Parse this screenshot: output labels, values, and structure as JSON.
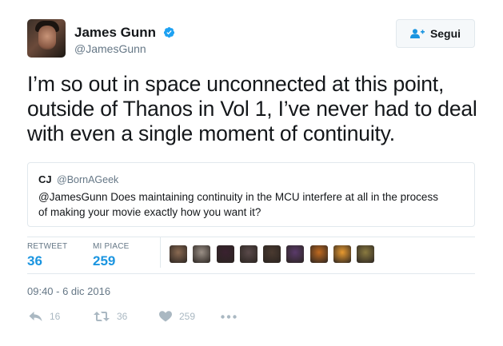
{
  "author": {
    "name": "James Gunn",
    "handle": "@JamesGunn",
    "avatar_icon": "profile-photo",
    "verified_icon": "verified-badge-icon",
    "verified_color": "#1da1f2"
  },
  "follow_button": {
    "label": "Segui",
    "icon": "add-user-icon"
  },
  "tweet": {
    "lines": [
      "I’m so out in space unconnected at this point,",
      "outside of Thanos in Vol 1, I’ve never had to deal",
      "with even a single moment of continuity."
    ]
  },
  "quoted_tweet": {
    "name": "CJ",
    "handle": "@BornAGeek",
    "lines": [
      "@JamesGunn Does maintaining continuity in the MCU interfere at all in the process",
      "of making your movie exactly how you want it?"
    ]
  },
  "stats": {
    "retweet_label": "RETWEET",
    "retweet_count": "36",
    "likes_label": "MI PIACE",
    "likes_count": "259"
  },
  "likers": {
    "icon": "liker-avatar",
    "colors": [
      "#8a6a52",
      "#9a8f86",
      "#3a2230",
      "#5a4a4a",
      "#4a3a30",
      "#5a3a6a",
      "#c06a20",
      "#e89a30",
      "#8a7a40"
    ]
  },
  "timestamp": "09:40 - 6 dic 2016",
  "actions": {
    "reply_count": "16",
    "retweet_count": "36",
    "like_count": "259",
    "reply_icon": "reply-icon",
    "retweet_icon": "retweet-icon",
    "like_icon": "heart-icon",
    "more_icon": "more-icon"
  },
  "colors": {
    "accent": "#1b95e0",
    "muted": "#657786",
    "border": "#e1e8ed",
    "action": "#aab8c2"
  }
}
